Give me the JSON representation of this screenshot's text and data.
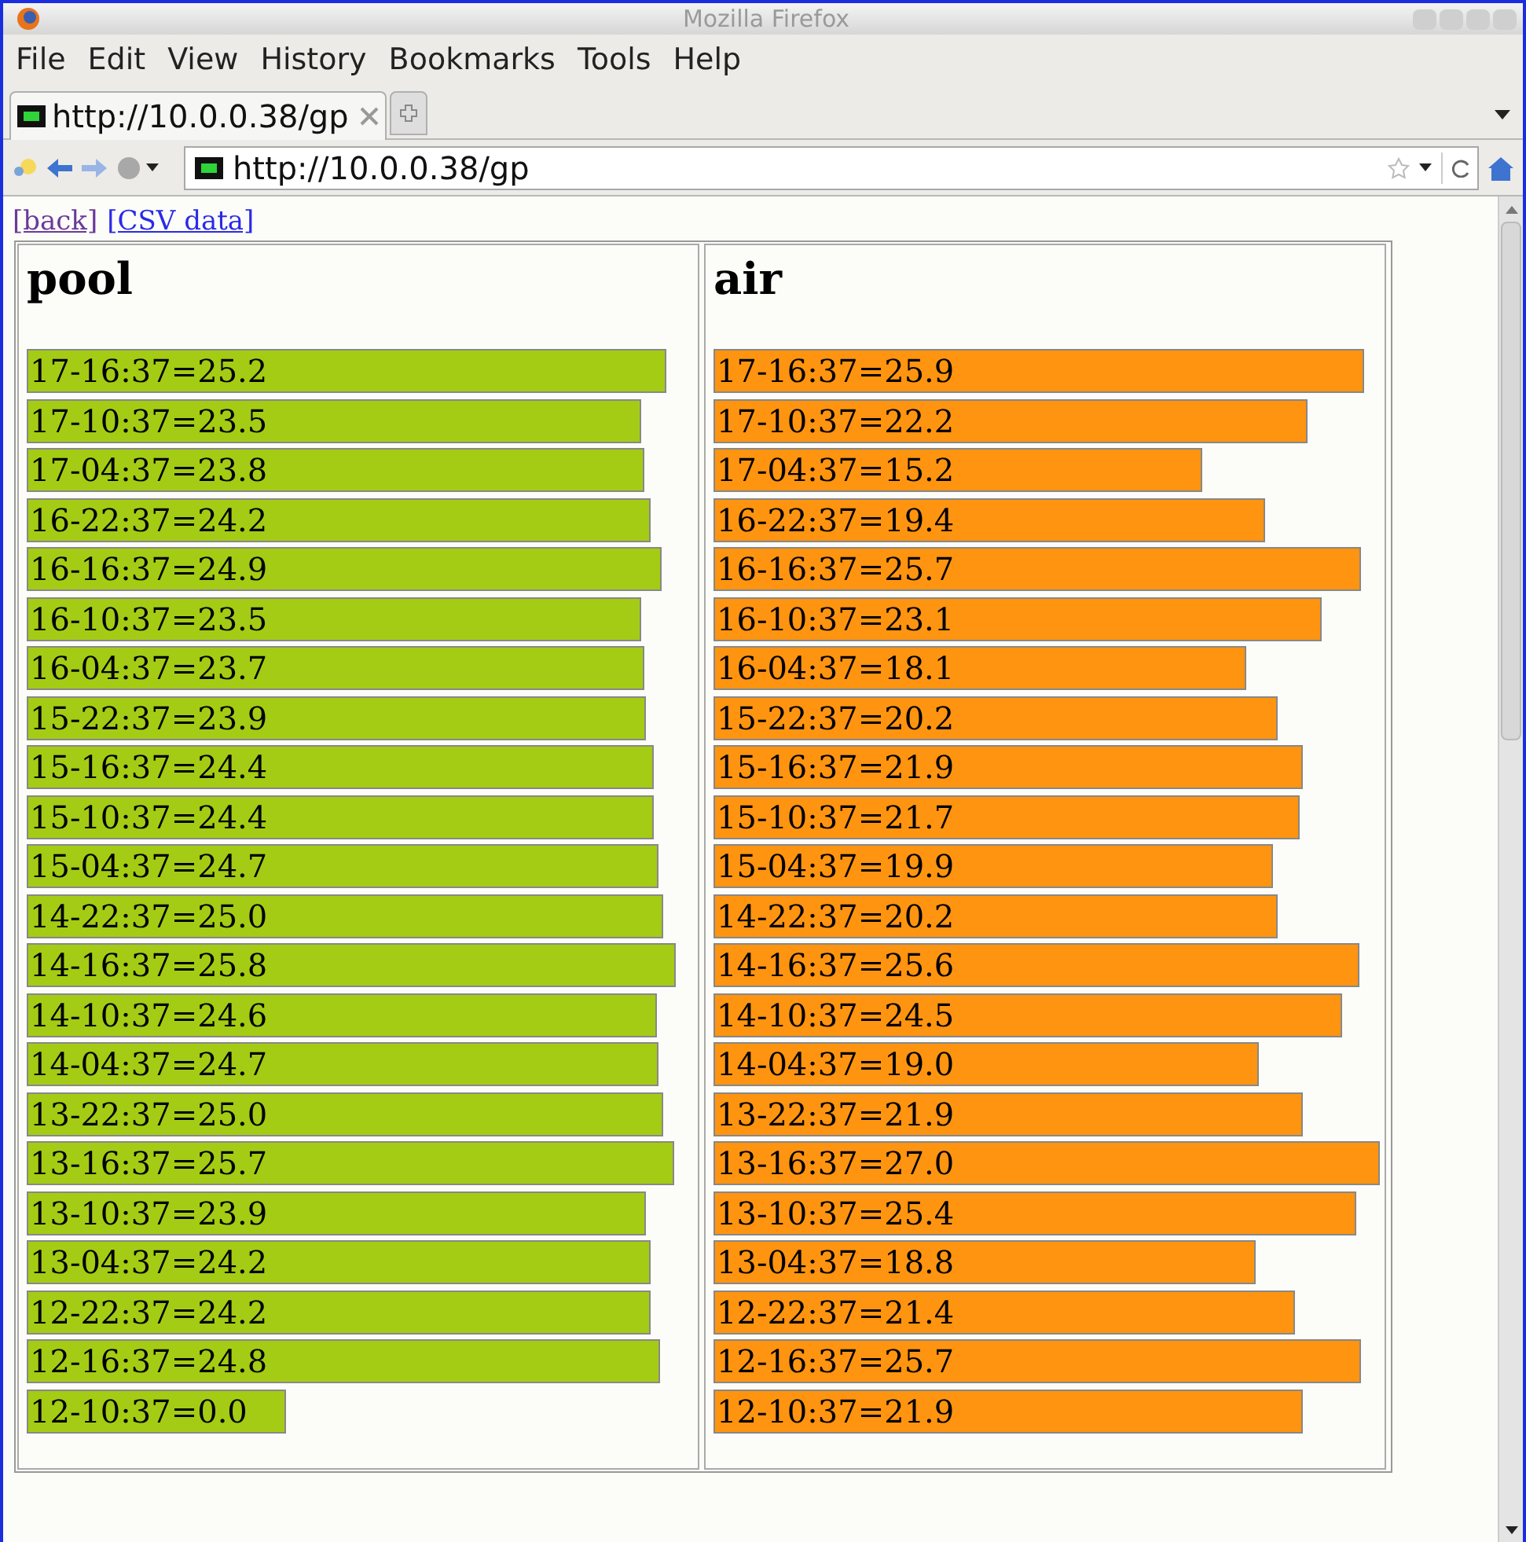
{
  "window": {
    "title": "Mozilla Firefox"
  },
  "menu": [
    "File",
    "Edit",
    "View",
    "History",
    "Bookmarks",
    "Tools",
    "Help"
  ],
  "tabs": [
    {
      "label": "http://10.0.0.38/gp",
      "selected": true
    }
  ],
  "address": {
    "value": "http://10.0.0.38/gp"
  },
  "links": [
    "[back]",
    "[CSV data]"
  ],
  "panels": [
    {
      "title": "pool",
      "color": "#a4cc14",
      "bars": [
        {
          "label": "17-16:37=25.2"
        },
        {
          "label": "17-10:37=23.5"
        },
        {
          "label": "17-04:37=23.8"
        },
        {
          "label": "16-22:37=24.2"
        },
        {
          "label": "16-16:37=24.9"
        },
        {
          "label": "16-10:37=23.5"
        },
        {
          "label": "16-04:37=23.7"
        },
        {
          "label": "15-22:37=23.9"
        },
        {
          "label": "15-16:37=24.4"
        },
        {
          "label": "15-10:37=24.4"
        },
        {
          "label": "15-04:37=24.7"
        },
        {
          "label": "14-22:37=25.0"
        },
        {
          "label": "14-16:37=25.8"
        },
        {
          "label": "14-10:37=24.6"
        },
        {
          "label": "14-04:37=24.7"
        },
        {
          "label": "13-22:37=25.0"
        },
        {
          "label": "13-16:37=25.7"
        },
        {
          "label": "13-10:37=23.9"
        },
        {
          "label": "13-04:37=24.2"
        },
        {
          "label": "12-22:37=24.2"
        },
        {
          "label": "12-16:37=24.8"
        },
        {
          "label": "12-10:37=0.0"
        }
      ]
    },
    {
      "title": "air",
      "color": "#ff9410",
      "bars": [
        {
          "label": "17-16:37=25.9"
        },
        {
          "label": "17-10:37=22.2"
        },
        {
          "label": "17-04:37=15.2"
        },
        {
          "label": "16-22:37=19.4"
        },
        {
          "label": "16-16:37=25.7"
        },
        {
          "label": "16-10:37=23.1"
        },
        {
          "label": "16-04:37=18.1"
        },
        {
          "label": "15-22:37=20.2"
        },
        {
          "label": "15-16:37=21.9"
        },
        {
          "label": "15-10:37=21.7"
        },
        {
          "label": "15-04:37=19.9"
        },
        {
          "label": "14-22:37=20.2"
        },
        {
          "label": "14-16:37=25.6"
        },
        {
          "label": "14-10:37=24.5"
        },
        {
          "label": "14-04:37=19.0"
        },
        {
          "label": "13-22:37=21.9"
        },
        {
          "label": "13-16:37=27.0"
        },
        {
          "label": "13-10:37=25.4"
        },
        {
          "label": "13-04:37=18.8"
        },
        {
          "label": "12-22:37=21.4"
        },
        {
          "label": "12-16:37=25.7"
        },
        {
          "label": "12-10:37=21.9"
        }
      ]
    }
  ]
}
